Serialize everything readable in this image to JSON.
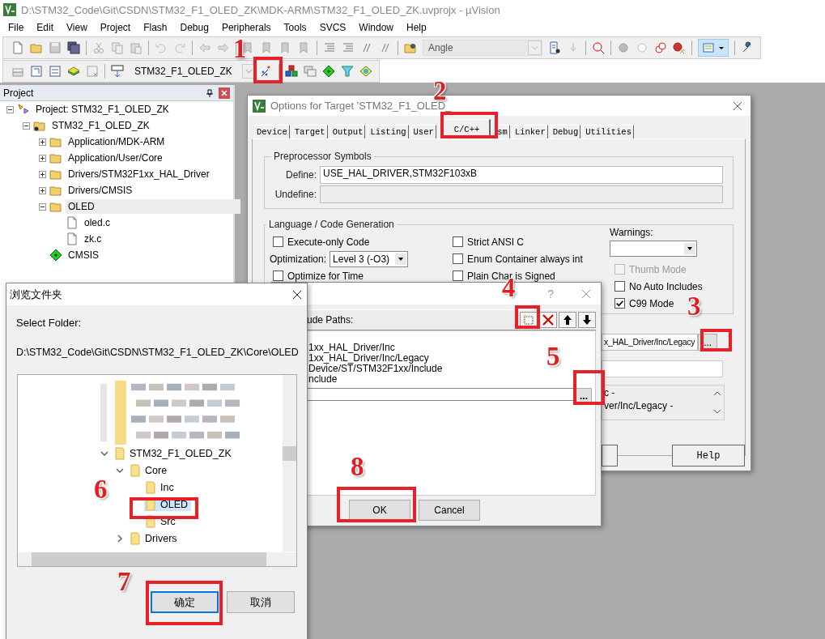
{
  "window": {
    "title": "D:\\STM32_Code\\Git\\CSDN\\STM32_F1_OLED_ZK\\MDK-ARM\\STM32_F1_OLED_ZK.uvprojx - µVision"
  },
  "menu": [
    "File",
    "Edit",
    "View",
    "Project",
    "Flash",
    "Debug",
    "Peripherals",
    "Tools",
    "SVCS",
    "Window",
    "Help"
  ],
  "toolbar": {
    "find_combo": {
      "value": "Angle"
    }
  },
  "build_toolbar": {
    "target_combo": {
      "value": "STM32_F1_OLED_ZK"
    }
  },
  "project_panel": {
    "title": "Project",
    "tree": [
      {
        "label": "Project: STM32_F1_OLED_ZK",
        "kind": "project",
        "expanded": true,
        "selected": false,
        "children": [
          {
            "label": "STM32_F1_OLED_ZK",
            "kind": "target",
            "expanded": true,
            "selected": false,
            "children": [
              {
                "label": "Application/MDK-ARM",
                "kind": "group",
                "expanded": false,
                "selected": false
              },
              {
                "label": "Application/User/Core",
                "kind": "group",
                "expanded": false,
                "selected": false
              },
              {
                "label": "Drivers/STM32F1xx_HAL_Driver",
                "kind": "group",
                "expanded": false,
                "selected": false
              },
              {
                "label": "Drivers/CMSIS",
                "kind": "group",
                "expanded": false,
                "selected": false
              },
              {
                "label": "OLED",
                "kind": "group",
                "expanded": true,
                "selected": true,
                "children": [
                  {
                    "label": "oled.c",
                    "kind": "file",
                    "selected": false
                  },
                  {
                    "label": "zk.c",
                    "kind": "file",
                    "selected": false
                  }
                ]
              },
              {
                "label": "CMSIS",
                "kind": "component",
                "selected": false
              }
            ]
          }
        ]
      }
    ]
  },
  "options_dialog": {
    "title": "Options for Target 'STM32_F1_OLED_",
    "tabs": [
      {
        "label": "Device",
        "selected": false
      },
      {
        "label": "Target",
        "selected": false
      },
      {
        "label": "Output",
        "selected": false
      },
      {
        "label": "Listing",
        "selected": false
      },
      {
        "label": "User",
        "selected": false
      },
      {
        "label": "C/C++",
        "selected": true
      },
      {
        "label": "sm",
        "selected": false
      },
      {
        "label": "Linker",
        "selected": false
      },
      {
        "label": "Debug",
        "selected": false
      },
      {
        "label": "Utilities",
        "selected": false
      }
    ],
    "preprocessor": {
      "title": "Preprocessor Symbols",
      "define": {
        "label": "Define:",
        "value": "USE_HAL_DRIVER,STM32F103xB"
      },
      "undefine": {
        "label": "Undefine:",
        "disabled": true
      }
    },
    "language": {
      "title": "Language / Code Generation",
      "columns": [
        [
          {
            "kind": "checkbox",
            "label": "Execute-only Code",
            "checked": false,
            "disabled": false
          },
          {
            "kind": "select",
            "label": "Optimization:",
            "value": "Level 3 (-O3)"
          },
          {
            "kind": "checkbox",
            "label": "Optimize for Time",
            "checked": false,
            "disabled": false
          }
        ],
        [
          {
            "kind": "checkbox",
            "label": "Strict ANSI C",
            "checked": false,
            "disabled": false
          },
          {
            "kind": "checkbox",
            "label": "Enum Container always int",
            "checked": false,
            "disabled": false
          },
          {
            "kind": "checkbox",
            "label": "Plain Char is Signed",
            "checked": false,
            "disabled": false
          }
        ],
        [
          {
            "kind": "labeled-select",
            "label": "Warnings:"
          },
          {
            "kind": "checkbox",
            "label": "Thumb Mode",
            "checked": false,
            "disabled": true
          },
          {
            "kind": "checkbox",
            "label": "No Auto Includes",
            "checked": false,
            "disabled": false
          },
          {
            "kind": "checkbox",
            "label": "C99 Mode",
            "checked": true,
            "disabled": false
          }
        ]
      ]
    },
    "include_paths_field": {
      "value": "x_HAL_Driver/Inc/Legacy",
      "browse": "..."
    },
    "compiler_string": [
      "c -",
      "ver/Inc/Legacy -"
    ],
    "buttons": [
      "Help"
    ]
  },
  "include_dialog": {
    "help": "?",
    "header": "ude Paths:",
    "paths": [
      "1xx_HAL_Driver/Inc",
      "1xx_HAL_Driver/Inc/Legacy",
      "Device/ST/STM32F1xx/Include",
      "nclude"
    ],
    "edit_button": "...",
    "buttons": [
      "OK",
      "Cancel"
    ]
  },
  "browse_dialog": {
    "title": "浏览文件夹",
    "prompt": "Select Folder:",
    "path": "D:\\STM32_Code\\Git\\CSDN\\STM32_F1_OLED_ZK\\Core\\OLED",
    "tree": [
      {
        "label": "STM32_F1_OLED_ZK",
        "expanded": true,
        "selected": false,
        "children": [
          {
            "label": "Core",
            "expanded": true,
            "selected": false,
            "children": [
              {
                "label": "Inc",
                "selected": false
              },
              {
                "label": "OLED",
                "selected": true
              },
              {
                "label": "Src",
                "selected": false
              }
            ]
          },
          {
            "label": "Drivers",
            "expanded": false,
            "selected": false
          }
        ]
      }
    ],
    "buttons": [
      {
        "label": "确定",
        "default": true
      },
      {
        "label": "取消",
        "default": false
      }
    ]
  },
  "callouts": [
    {
      "number": "1"
    },
    {
      "number": "2"
    },
    {
      "number": "3"
    },
    {
      "number": "4"
    },
    {
      "number": "5"
    },
    {
      "number": "6"
    },
    {
      "number": "7"
    },
    {
      "number": "8"
    }
  ]
}
